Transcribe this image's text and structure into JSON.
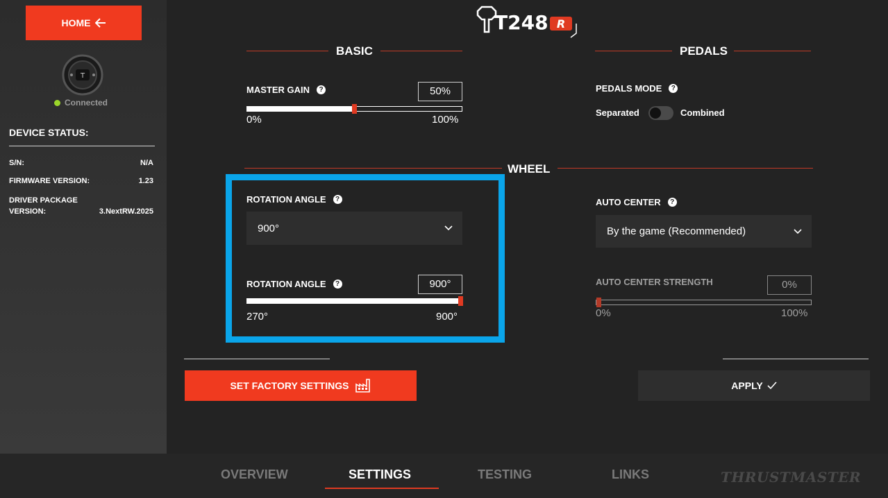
{
  "sidebar": {
    "home_label": "HOME",
    "connection_status": "Connected",
    "device_status_title": "DEVICE STATUS:",
    "info": [
      {
        "key": "S/N:",
        "value": "N/A"
      },
      {
        "key": "FIRMWARE VERSION:",
        "value": "1.23"
      },
      {
        "key": "DRIVER PACKAGE VERSION:",
        "value": "3.NextRW.2025"
      }
    ],
    "status_color": "#9bd62a"
  },
  "logo": {
    "model": "T248",
    "badge": "R"
  },
  "basic": {
    "title": "BASIC",
    "master_gain": {
      "label": "MASTER GAIN",
      "value": "50%",
      "min": "0%",
      "max": "100%",
      "fraction": 0.5
    }
  },
  "pedals": {
    "title": "PEDALS",
    "mode_label": "PEDALS MODE",
    "left_option": "Separated",
    "right_option": "Combined",
    "state": "Separated"
  },
  "wheel": {
    "title": "WHEEL",
    "rotation_select": {
      "label": "ROTATION ANGLE",
      "value": "900°"
    },
    "rotation_slider": {
      "label": "ROTATION ANGLE",
      "value": "900°",
      "min": "270°",
      "max": "900°",
      "fraction": 1.0
    },
    "auto_center": {
      "label": "AUTO CENTER",
      "value": "By the game (Recommended)"
    },
    "auto_center_strength": {
      "label": "AUTO CENTER STRENGTH",
      "value": "0%",
      "min": "0%",
      "max": "100%",
      "fraction": 0.0
    }
  },
  "buttons": {
    "factory": "SET FACTORY SETTINGS",
    "apply": "APPLY"
  },
  "nav": {
    "tabs": [
      "OVERVIEW",
      "SETTINGS",
      "TESTING",
      "LINKS"
    ],
    "active": "SETTINGS",
    "brand": "THRUSTMASTER"
  },
  "colors": {
    "accent": "#f03a1f",
    "highlight": "#0aa5ea",
    "background": "#232323"
  }
}
